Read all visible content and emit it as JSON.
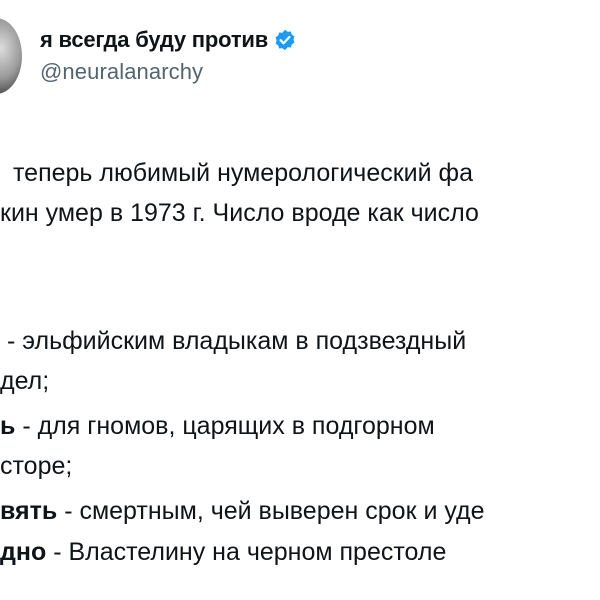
{
  "author": {
    "display_name": "я всегда буду против",
    "handle": "@neuralanarchy",
    "verified_icon": "verified-badge-icon",
    "verified_color": "#1d9bf0"
  },
  "tweet": {
    "intro_line_1": "теперь любимый нумерологический фа",
    "intro_line_2": "кин умер в 1973 г. Число вроде как число",
    "items": [
      {
        "bold": "",
        "text": " - эльфийским владыкам в подзвездный"
      },
      {
        "bold": "",
        "text": "дел;"
      },
      {
        "bold": "ь",
        "text": " - для гномов, царящих в подгорном"
      },
      {
        "bold": "",
        "text": "сторе;"
      },
      {
        "bold": "вять",
        "text": " - смертным, чей выверен срок и уде"
      },
      {
        "bold": "дно",
        "text": " - Властелину на черном престоле"
      }
    ]
  }
}
